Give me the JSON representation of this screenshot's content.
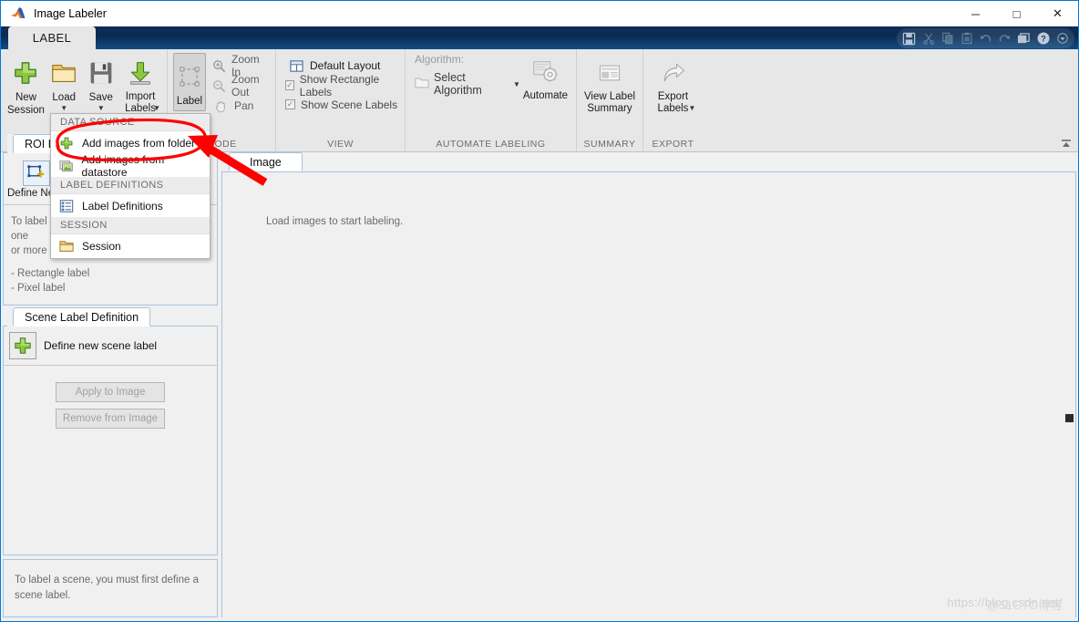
{
  "window": {
    "title": "Image Labeler",
    "app_icon": "matlab-icon",
    "minimize_label": "─",
    "maximize_label": "□",
    "close_label": "✕"
  },
  "ribbon": {
    "tab_label": "LABEL",
    "collapse_icon": "collapse-ribbon-icon",
    "quick_access": [
      {
        "name": "save-icon",
        "glyph": "save",
        "enabled": true
      },
      {
        "name": "cut-icon",
        "glyph": "cut",
        "enabled": false
      },
      {
        "name": "copy-icon",
        "glyph": "copy",
        "enabled": false
      },
      {
        "name": "paste-icon",
        "glyph": "paste",
        "enabled": false
      },
      {
        "name": "undo-icon",
        "glyph": "undo",
        "enabled": false
      },
      {
        "name": "redo-icon",
        "glyph": "redo",
        "enabled": false
      },
      {
        "name": "layout-icon",
        "glyph": "layout",
        "enabled": true
      },
      {
        "name": "help-icon",
        "glyph": "help",
        "enabled": true
      },
      {
        "name": "qat-dropdown-icon",
        "glyph": "chevron",
        "enabled": true
      }
    ],
    "groups": [
      {
        "id": "file",
        "title": "DATA SOURCE",
        "buttons": [
          {
            "label_line1": "New",
            "label_line2": "Session",
            "icon": "new-session-icon",
            "has_caret": false
          },
          {
            "label_line1": "Load",
            "label_line2": "",
            "icon": "load-folder-icon",
            "has_caret": true
          },
          {
            "label_line1": "Save",
            "label_line2": "",
            "icon": "save-disk-icon",
            "has_caret": true
          },
          {
            "label_line1": "Import",
            "label_line2": "Labels",
            "icon": "import-labels-icon",
            "has_caret": true
          }
        ]
      },
      {
        "id": "mode",
        "title": "MODE",
        "big_button": {
          "label": "Label",
          "icon": "label-roi-icon",
          "pressed": true
        },
        "items": [
          {
            "label": "Zoom In",
            "icon": "zoom-in-icon"
          },
          {
            "label": "Zoom Out",
            "icon": "zoom-out-icon"
          },
          {
            "label": "Pan",
            "icon": "pan-hand-icon"
          }
        ]
      },
      {
        "id": "view",
        "title": "VIEW",
        "layout_item": {
          "label": "Default Layout",
          "icon": "layout-grid-icon"
        },
        "checkboxes": [
          {
            "label": "Show Rectangle Labels",
            "checked": true
          },
          {
            "label": "Show Scene Labels",
            "checked": true
          }
        ]
      },
      {
        "id": "automate",
        "title": "AUTOMATE LABELING",
        "algorithm_label": "Algorithm:",
        "select_algorithm": "Select Algorithm",
        "automate_button": {
          "label": "Automate",
          "icon": "automate-gear-icon"
        }
      },
      {
        "id": "summary",
        "title": "SUMMARY",
        "button": {
          "label_line1": "View Label",
          "label_line2": "Summary",
          "icon": "view-summary-icon"
        }
      },
      {
        "id": "export",
        "title": "EXPORT",
        "button": {
          "label_line1": "Export",
          "label_line2": "Labels",
          "icon": "export-labels-icon",
          "has_caret": true
        }
      }
    ]
  },
  "load_menu": {
    "sections": [
      {
        "header": "DATA SOURCE",
        "items": [
          {
            "label": "Add images from folder",
            "icon": "add-plus-icon",
            "highlighted": true
          },
          {
            "label": "Add images from datastore",
            "icon": "datastore-icon",
            "highlighted": false
          }
        ]
      },
      {
        "header": "LABEL DEFINITIONS",
        "items": [
          {
            "label": "Label Definitions",
            "icon": "label-definitions-icon",
            "highlighted": false
          }
        ]
      },
      {
        "header": "SESSION",
        "items": [
          {
            "label": "Session",
            "icon": "folder-icon",
            "highlighted": false
          }
        ]
      }
    ]
  },
  "roi_panel": {
    "tab_label": "ROI Label Definition",
    "define_button": {
      "label": "Define New ROI",
      "icon": "define-roi-icon"
    },
    "hint_line1": "To label an image, you must first define one",
    "hint_line2": "or more ROI labels.",
    "hint_item1": "- Rectangle label",
    "hint_item2": "- Pixel label"
  },
  "scene_panel": {
    "tab_label": "Scene Label Definition",
    "define_label": "Define new scene label",
    "define_icon": "add-plus-icon",
    "apply_button": "Apply to Image",
    "remove_button": "Remove from Image",
    "note_line1": "To label a scene, you must first define a",
    "note_line2": "scene label."
  },
  "image_panel": {
    "tab_label": "Image",
    "empty_message": "Load images to start labeling."
  },
  "watermark": {
    "text": "https://blog.csdn.net/",
    "overlay": "@51CTO博客"
  },
  "colors": {
    "ribbon_header": "#0c2d56",
    "ribbon_bg": "#e7e7e7",
    "panel_border": "#a9c3dd",
    "annotation_red": "#ff0000",
    "plus_green": "#7dbb42",
    "body_bg": "#f0f0f0"
  }
}
